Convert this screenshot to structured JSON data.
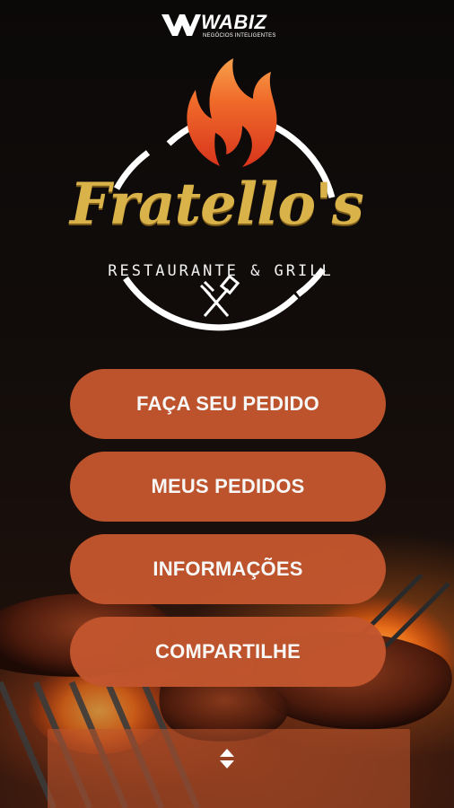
{
  "brand": {
    "name": "WABIZ",
    "tagline": "NEGÓCIOS INTELIGENTES"
  },
  "restaurant": {
    "name": "Fratello's",
    "subtitle": "RESTAURANTE & GRILL"
  },
  "menu": {
    "items": [
      {
        "label": "FAÇA SEU PEDIDO"
      },
      {
        "label": "MEUS PEDIDOS"
      },
      {
        "label": "INFORMAÇÕES"
      },
      {
        "label": "COMPARTILHE"
      }
    ]
  },
  "colors": {
    "button": "#c2562e",
    "gold": "#d9b24a",
    "flame": "#e8582a"
  },
  "icons": {
    "brand": "wabiz-logo-icon",
    "flame": "flame-icon",
    "utensils": "grill-utensils-icon",
    "scroll": "scroll-arrows-icon"
  }
}
